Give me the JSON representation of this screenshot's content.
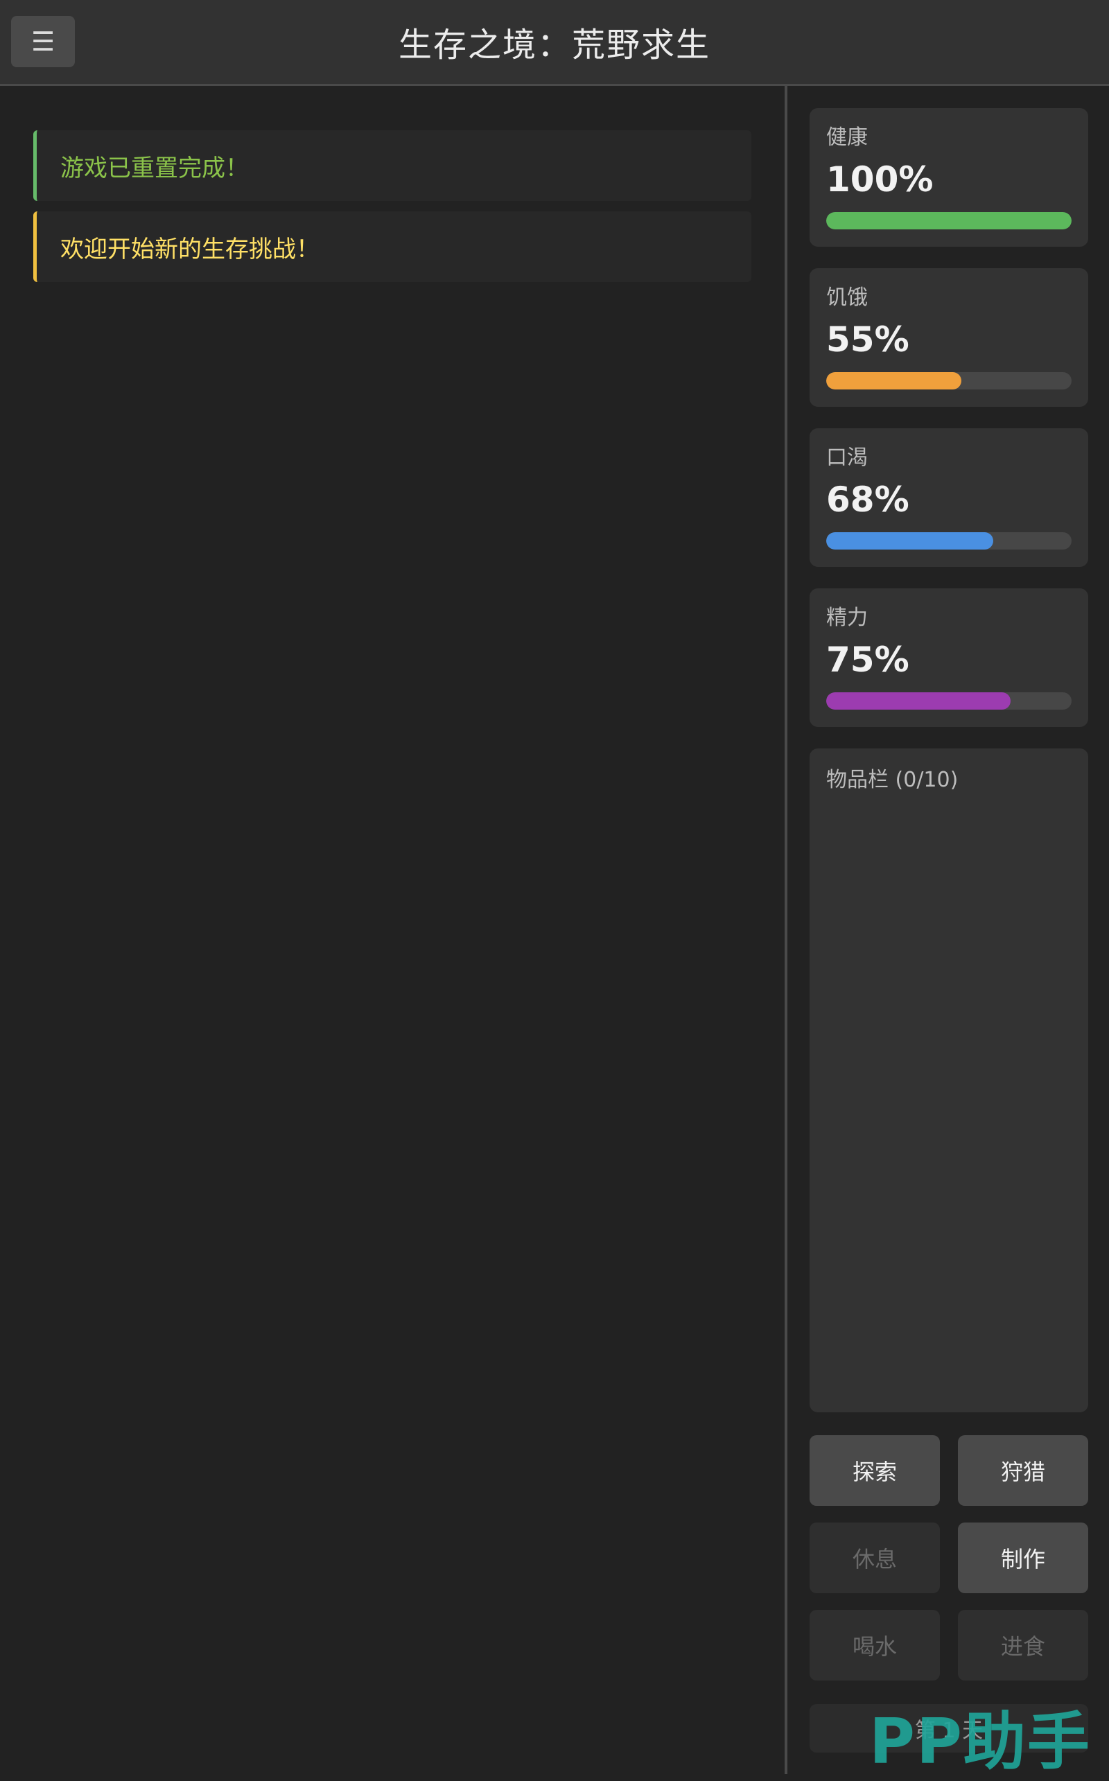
{
  "header": {
    "menu_icon": "☰",
    "title": "生存之境：荒野求生"
  },
  "log": {
    "messages": [
      {
        "text": "游戏已重置完成！",
        "type": "success",
        "color": "#8bc34a"
      },
      {
        "text": "欢迎开始新的生存挑战！",
        "type": "info",
        "color": "#ffe066"
      }
    ]
  },
  "stats": [
    {
      "label": "健康",
      "value": "100%",
      "percent": 100,
      "color": "#5cb85c"
    },
    {
      "label": "饥饿",
      "value": "55%",
      "percent": 55,
      "color": "#f0a03c"
    },
    {
      "label": "口渴",
      "value": "68%",
      "percent": 68,
      "color": "#4a90e2"
    },
    {
      "label": "精力",
      "value": "75%",
      "percent": 75,
      "color": "#9c3cb0"
    }
  ],
  "inventory": {
    "title": "物品栏 (0/10)"
  },
  "actions": [
    {
      "label": "探索",
      "enabled": true
    },
    {
      "label": "狩猎",
      "enabled": true
    },
    {
      "label": "休息",
      "enabled": false
    },
    {
      "label": "制作",
      "enabled": true
    },
    {
      "label": "喝水",
      "enabled": false
    },
    {
      "label": "进食",
      "enabled": false
    }
  ],
  "day_label": "第 1 天",
  "watermark": "PP助手"
}
